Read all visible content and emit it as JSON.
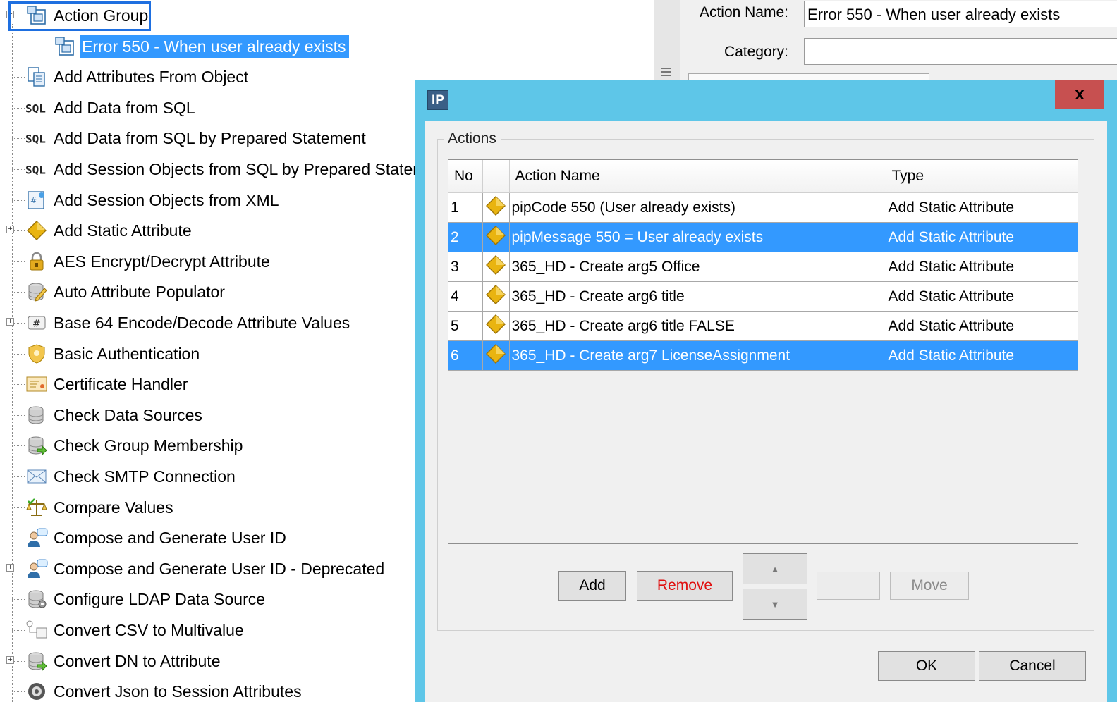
{
  "tree": {
    "items": [
      {
        "label": "Action Group",
        "icon": "action-group-icon",
        "expandable": true
      },
      {
        "label": "Error 550 - When user already exists",
        "icon": "action-group-icon",
        "selected": true
      },
      {
        "label": "Add Attributes From Object",
        "icon": "document-copy-icon"
      },
      {
        "label": "Add Data from SQL",
        "icon": "sql-icon"
      },
      {
        "label": "Add Data from SQL by Prepared Statement",
        "icon": "sql-icon"
      },
      {
        "label": "Add Session Objects from SQL by Prepared Statement",
        "icon": "sql-icon"
      },
      {
        "label": "Add Session Objects from XML",
        "icon": "xml-icon"
      },
      {
        "label": "Add Static Attribute",
        "icon": "diamond-icon",
        "expandable": true
      },
      {
        "label": "AES Encrypt/Decrypt Attribute",
        "icon": "lock-icon"
      },
      {
        "label": "Auto Attribute Populator",
        "icon": "pencil-database-icon"
      },
      {
        "label": "Base 64 Encode/Decode Attribute Values",
        "icon": "hash-icon",
        "expandable": true
      },
      {
        "label": "Basic Authentication",
        "icon": "shield-icon"
      },
      {
        "label": "Certificate Handler",
        "icon": "certificate-icon"
      },
      {
        "label": "Check Data Sources",
        "icon": "database-icon"
      },
      {
        "label": "Check Group Membership",
        "icon": "database-arrow-icon"
      },
      {
        "label": "Check SMTP Connection",
        "icon": "envelope-icon"
      },
      {
        "label": "Compare Values",
        "icon": "scales-icon"
      },
      {
        "label": "Compose and Generate User ID",
        "icon": "user-icon"
      },
      {
        "label": "Compose and Generate User ID - Deprecated",
        "icon": "user-icon",
        "expandable": true
      },
      {
        "label": "Configure LDAP Data Source",
        "icon": "database-gear-icon"
      },
      {
        "label": "Convert CSV to Multivalue",
        "icon": "csv-convert-icon"
      },
      {
        "label": "Convert DN to Attribute",
        "icon": "database-arrow-icon",
        "expandable": true
      },
      {
        "label": "Convert Json to Session Attributes",
        "icon": "json-icon"
      }
    ]
  },
  "right_panel": {
    "action_name_label": "Action Name:",
    "action_name_value": "Error 550 - When user already exists",
    "category_label": "Category:",
    "category_value": ""
  },
  "dialog": {
    "app_icon_text": "IP",
    "close_glyph": "x",
    "group_label": "Actions",
    "columns": [
      "No",
      "",
      "Action Name",
      "Type"
    ],
    "rows": [
      {
        "no": "1",
        "name": "pipCode 550 (User already exists)",
        "type": "Add Static Attribute",
        "selected": false
      },
      {
        "no": "2",
        "name": "pipMessage 550 = User already exists",
        "type": "Add Static Attribute",
        "selected": true
      },
      {
        "no": "3",
        "name": "365_HD - Create arg5 Office",
        "type": "Add Static Attribute",
        "selected": false
      },
      {
        "no": "4",
        "name": "365_HD - Create arg6 title",
        "type": "Add Static Attribute",
        "selected": false
      },
      {
        "no": "5",
        "name": "365_HD - Create arg6 title FALSE",
        "type": "Add Static Attribute",
        "selected": false
      },
      {
        "no": "6",
        "name": "365_HD - Create arg7 LicenseAssignment",
        "type": "Add Static Attribute",
        "selected": true
      }
    ],
    "buttons": {
      "add": "Add",
      "remove": "Remove",
      "move_up": "▲",
      "move_down": "▼",
      "blank": "",
      "move": "Move",
      "ok": "OK",
      "cancel": "Cancel"
    }
  },
  "colors": {
    "selection": "#3399ff",
    "dialog_frame": "#5ec6e8",
    "close_button": "#c75050",
    "remove_text": "#e01010",
    "focus_border": "#1e6fe0"
  }
}
